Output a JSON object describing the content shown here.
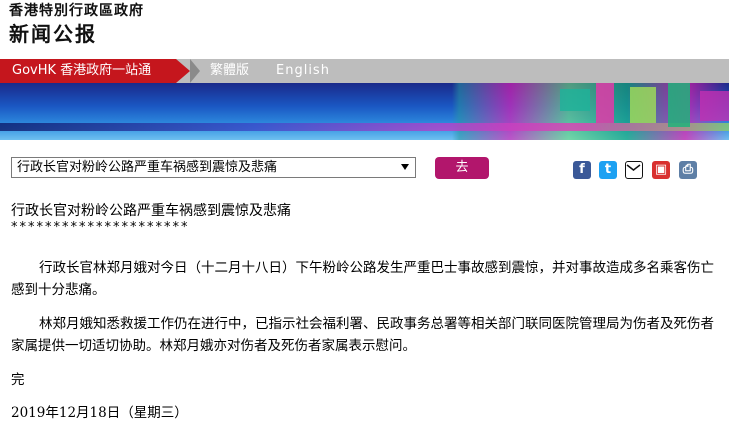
{
  "header": {
    "government": "香港特別行政區政府",
    "site_title": "新闻公报"
  },
  "nav": {
    "govhk": "GovHK 香港政府一站通",
    "traditional": "繁體版",
    "english": "English"
  },
  "selector": {
    "selected": "行政长官对粉岭公路严重车祸感到震惊及悲痛",
    "go_label": "去"
  },
  "share_icons": [
    "facebook-icon",
    "twitter-icon",
    "email-icon",
    "weibo-icon",
    "print-icon"
  ],
  "article": {
    "title": "行政长官对粉岭公路严重车祸感到震惊及悲痛",
    "stars": "*********************",
    "paragraphs": [
      "行政长官林郑月娥对今日（十二月十八日）下午粉岭公路发生严重巴士事故感到震惊，并对事故造成多名乘客伤亡感到十分悲痛。",
      "林郑月娥知悉救援工作仍在进行中，已指示社会福利署、民政事务总署等相关部门联同医院管理局为伤者及死伤者家属提供一切适切协助。林郑月娥亦对伤者及死伤者家属表示慰问。"
    ],
    "end": "完",
    "date": "2019年12月18日（星期三）"
  },
  "colors": {
    "govhk_red": "#c5161d",
    "go_button": "#b2166c",
    "nav_gray": "#bdbdbd"
  }
}
